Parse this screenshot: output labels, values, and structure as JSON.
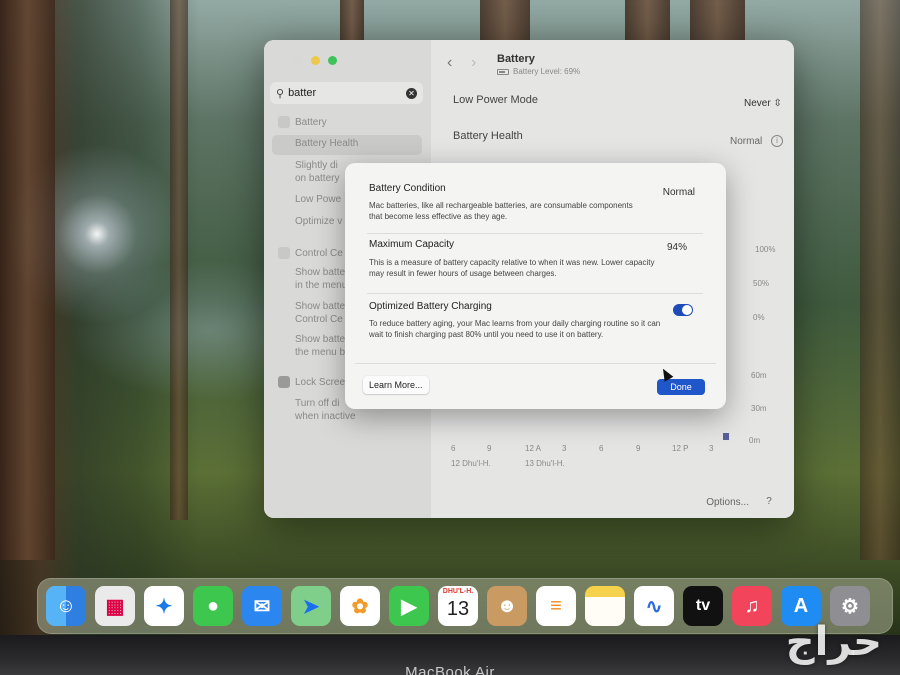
{
  "settings": {
    "search": {
      "value": "batter"
    },
    "sidebar": {
      "items": [
        {
          "label": "Battery",
          "type": "header"
        },
        {
          "label": "Battery Health",
          "type": "item"
        },
        {
          "label": "Slightly di",
          "type": "item"
        },
        {
          "label": "on battery",
          "type": "item"
        },
        {
          "label": "Low Powe",
          "type": "item"
        },
        {
          "label": "Optimize v",
          "type": "item"
        },
        {
          "label": "Control Ce",
          "type": "header"
        },
        {
          "label": "Show batte",
          "type": "item"
        },
        {
          "label": "in the menu",
          "type": "item"
        },
        {
          "label": "Show batte",
          "type": "item"
        },
        {
          "label": "Control Ce",
          "type": "item"
        },
        {
          "label": "Show batte",
          "type": "item"
        },
        {
          "label": "the menu b",
          "type": "item"
        },
        {
          "label": "Lock Scree",
          "type": "header"
        },
        {
          "label": "Turn off di",
          "type": "item"
        },
        {
          "label": "when inactive",
          "type": "item"
        }
      ]
    },
    "content": {
      "title": "Battery",
      "subtitle": "Battery Level: 69%",
      "low_power_label": "Low Power Mode",
      "low_power_value": "Never",
      "health_label": "Battery Health",
      "health_value": "Normal",
      "right_axis": [
        "100%",
        "50%",
        "0%",
        "60m",
        "30m",
        "0m"
      ],
      "x_axis": [
        "6",
        "9",
        "12 A",
        "3",
        "6",
        "9",
        "12 P",
        "3"
      ],
      "date_labels": [
        "12 Dhu'l-H.",
        "13 Dhu'l-H."
      ],
      "options_label": "Options...",
      "help_label": "?"
    }
  },
  "sheet": {
    "condition_title": "Battery Condition",
    "condition_value": "Normal",
    "condition_desc": "Mac batteries, like all rechargeable batteries, are consumable components that become less effective as they age.",
    "capacity_title": "Maximum Capacity",
    "capacity_value": "94%",
    "capacity_desc": "This is a measure of battery capacity relative to when it was new. Lower capacity may result in fewer hours of usage between charges.",
    "optimized_title": "Optimized Battery Charging",
    "optimized_enabled": true,
    "optimized_desc": "To reduce battery aging, your Mac learns from your daily charging routine so it can wait to finish charging past 80% until you need to use it on battery.",
    "learn_more_label": "Learn More...",
    "done_label": "Done"
  },
  "dock": {
    "apps": [
      "finder-icon",
      "launchpad-icon",
      "safari-icon",
      "messages-icon",
      "mail-icon",
      "maps-icon",
      "photos-icon",
      "facetime-icon",
      "calendar-icon",
      "contacts-icon",
      "reminders-icon",
      "notes-icon",
      "freeform-icon",
      "appletv-icon",
      "music-icon",
      "appstore-icon",
      "system-settings-icon"
    ],
    "calendar_month": "DHU'L-H.",
    "calendar_day": "13",
    "tv_label": "tv"
  },
  "device": {
    "label": "MacBook Air"
  },
  "watermark": {
    "text": "حراج"
  }
}
